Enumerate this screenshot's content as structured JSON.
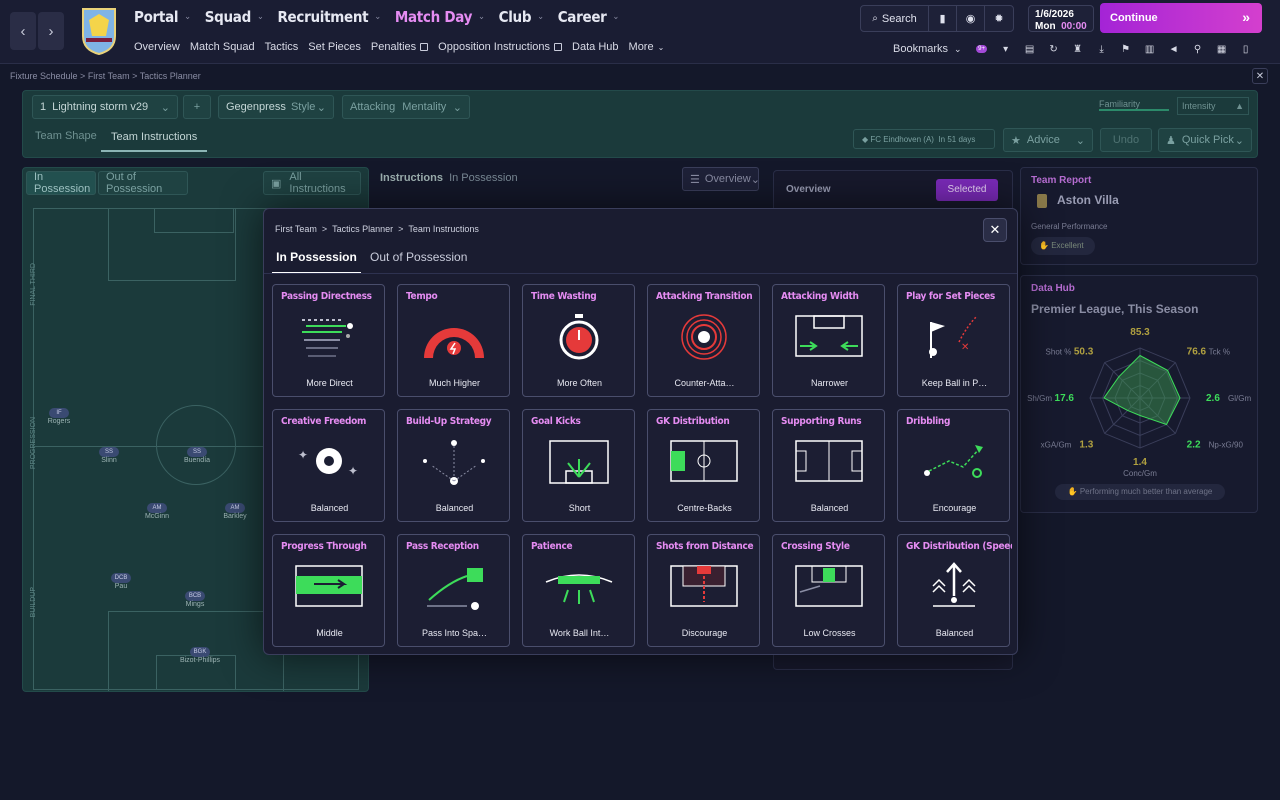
{
  "nav": {
    "back": "‹",
    "forward": "›",
    "main": [
      {
        "label": "Portal",
        "active": false
      },
      {
        "label": "Squad",
        "active": false
      },
      {
        "label": "Recruitment",
        "active": false
      },
      {
        "label": "Match Day",
        "active": true
      },
      {
        "label": "Club",
        "active": false
      },
      {
        "label": "Career",
        "active": false
      }
    ],
    "sub": [
      "Overview",
      "Match Squad",
      "Tactics",
      "Set Pieces",
      "Penalties",
      "Opposition Instructions",
      "Data Hub",
      "More"
    ],
    "search_label": "Search",
    "date": "1/6/2026",
    "day": "Mon",
    "time": "00:00",
    "continue_label": "Continue",
    "bookmarks_label": "Bookmarks",
    "notif_count": "9+"
  },
  "breadcrumb": [
    "Fixture Schedule",
    "First Team",
    "Tactics Planner"
  ],
  "tactics": {
    "tactic_number": "1",
    "tactic_name": "Lightning storm v29",
    "style_value": "Gegenpress",
    "style_label": "Style",
    "mentality_value": "Attacking",
    "mentality_label": "Mentality",
    "familiarity_label": "Familiarity",
    "intensity_label": "Intensity",
    "tabs": [
      "Team Shape",
      "Team Instructions"
    ],
    "opponent": "FC Eindhoven (A)",
    "opponent_when": "In 51 days",
    "advice": "Advice",
    "undo": "Undo",
    "quick_pick": "Quick Pick"
  },
  "pitch_panel": {
    "tabs": [
      "In Possession",
      "Out of Possession"
    ],
    "all_instructions": "All Instructions",
    "zones": [
      "FINAL THIRD",
      "PROGRESSION",
      "BUILDUP"
    ],
    "players": [
      {
        "pos": "IF",
        "name": "Rogers"
      },
      {
        "pos": "SS",
        "name": "Slinn"
      },
      {
        "pos": "SS",
        "name": "Buendía"
      },
      {
        "pos": "AM",
        "name": "McGinn"
      },
      {
        "pos": "AM",
        "name": "Barkley"
      },
      {
        "pos": "DCB",
        "name": "Pau"
      },
      {
        "pos": "BCB",
        "name": "Mings"
      },
      {
        "pos": "BGK",
        "name": "Bizot-Phillips"
      }
    ]
  },
  "instructions_header": {
    "title": "Instructions",
    "sub": "In Possession",
    "view": "Overview"
  },
  "overview": {
    "title": "Overview",
    "selected": "Selected"
  },
  "team_report": {
    "title": "Team Report",
    "team": "Aston Villa",
    "label": "General Performance",
    "rating": "Excellent"
  },
  "data_hub": {
    "title": "Data Hub",
    "subtitle": "Premier League, This Season",
    "stats": [
      {
        "label": "Pas %",
        "value": "85.3"
      },
      {
        "label": "Tck %",
        "value": "76.6"
      },
      {
        "label": "Gl/Gm",
        "value": "2.6"
      },
      {
        "label": "Np-xG/90",
        "value": "2.2"
      },
      {
        "label": "Conc/Gm",
        "value": "1.4"
      },
      {
        "label": "xGA/Gm",
        "value": "1.3"
      },
      {
        "label": "Sh/Gm",
        "value": "17.6"
      },
      {
        "label": "Shot %",
        "value": "50.3"
      }
    ],
    "radar_levels": [
      0.85,
      0.78,
      0.8,
      0.75,
      0.35,
      0.35,
      0.72,
      0.6
    ],
    "footer": "Performing much better than average"
  },
  "modal": {
    "breadcrumb": [
      "First Team",
      "Tactics Planner",
      "Team Instructions"
    ],
    "tabs": [
      "In Possession",
      "Out of Possession"
    ],
    "cards": [
      {
        "title": "Passing Directness",
        "value": "More Direct",
        "icon": "passing-icon"
      },
      {
        "title": "Tempo",
        "value": "Much Higher",
        "icon": "tempo-gauge-icon"
      },
      {
        "title": "Time Wasting",
        "value": "More Often",
        "icon": "stopwatch-icon"
      },
      {
        "title": "Attacking Transition",
        "value": "Counter-Atta…",
        "icon": "counter-attack-icon"
      },
      {
        "title": "Attacking Width",
        "value": "Narrower",
        "icon": "width-icon"
      },
      {
        "title": "Play for Set Pieces",
        "value": "Keep Ball in P…",
        "icon": "set-piece-flag-icon"
      },
      {
        "title": "Creative Freedom",
        "value": "Balanced",
        "icon": "football-sparkle-icon"
      },
      {
        "title": "Build-Up Strategy",
        "value": "Balanced",
        "icon": "buildup-icon"
      },
      {
        "title": "Goal Kicks",
        "value": "Short",
        "icon": "goal-kick-icon"
      },
      {
        "title": "GK Distribution",
        "value": "Centre-Backs",
        "icon": "gk-distribution-icon"
      },
      {
        "title": "Supporting Runs",
        "value": "Balanced",
        "icon": "supporting-runs-icon"
      },
      {
        "title": "Dribbling",
        "value": "Encourage",
        "icon": "dribbling-icon"
      },
      {
        "title": "Progress Through",
        "value": "Middle",
        "icon": "progress-middle-icon"
      },
      {
        "title": "Pass Reception",
        "value": "Pass Into Spa…",
        "icon": "pass-reception-icon"
      },
      {
        "title": "Patience",
        "value": "Work Ball Int…",
        "icon": "patience-icon"
      },
      {
        "title": "Shots from Distance",
        "value": "Discourage",
        "icon": "shots-distance-icon"
      },
      {
        "title": "Crossing Style",
        "value": "Low Crosses",
        "icon": "crossing-icon"
      },
      {
        "title": "GK Distribution (Speed)",
        "value": "Balanced",
        "icon": "gk-speed-icon"
      }
    ]
  },
  "colors": {
    "accent": "#e58cf2",
    "green": "#3ddc5a",
    "red": "#e53a3a",
    "panel_teal": "#1b3a3b"
  }
}
